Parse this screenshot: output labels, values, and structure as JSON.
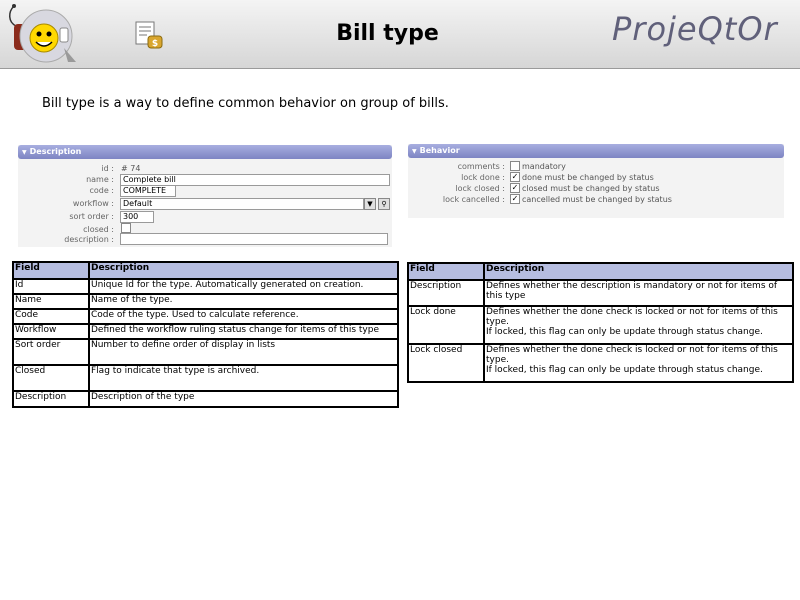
{
  "header": {
    "title": "Bill type",
    "brand": "ProjeQtOr"
  },
  "intro": "Bill type is a way to define common behavior on group of bills.",
  "description_panel": {
    "title": "Description",
    "id_label": "id :",
    "id_value": "# 74",
    "name_label": "name :",
    "name_value": "Complete bill",
    "code_label": "code :",
    "code_value": "COMPLETE",
    "workflow_label": "workflow :",
    "workflow_value": "Default",
    "sort_order_label": "sort order :",
    "sort_order_value": "300",
    "closed_label": "closed :",
    "description_label": "description :",
    "description_value": ""
  },
  "behavior_panel": {
    "title": "Behavior",
    "rows": [
      {
        "label": "comments :",
        "text": "mandatory",
        "checked": false
      },
      {
        "label": "lock done :",
        "text": "done must be changed by status",
        "checked": true
      },
      {
        "label": "lock closed :",
        "text": "closed must be changed by status",
        "checked": true
      },
      {
        "label": "lock cancelled :",
        "text": "cancelled must be changed by status",
        "checked": true
      }
    ]
  },
  "fields_table": {
    "headers": [
      "Field",
      "Description"
    ],
    "rows": [
      [
        "Id",
        "Unique Id for the type. Automatically generated on creation."
      ],
      [
        "Name",
        "Name of the type."
      ],
      [
        "Code",
        "Code of the type. Used to calculate reference."
      ],
      [
        "Workflow",
        "Defined the workflow ruling status change for items of this type"
      ],
      [
        "Sort order",
        "Number to define order of display in lists"
      ],
      [
        "Closed",
        "Flag to indicate that type is archived."
      ],
      [
        "Description",
        "Description of the type"
      ]
    ]
  },
  "behavior_table": {
    "headers": [
      "Field",
      "Description"
    ],
    "rows": [
      [
        "Description",
        "Defines whether the description is mandatory or not for items of this type",
        ""
      ],
      [
        "Lock done",
        "Defines whether the done check is locked or not for items of this type.",
        "If locked, this flag can only be update through status change."
      ],
      [
        "Lock closed",
        "Defines whether the done check is locked or not for items of this type.",
        "If locked, this flag can only be update through status change."
      ]
    ]
  }
}
